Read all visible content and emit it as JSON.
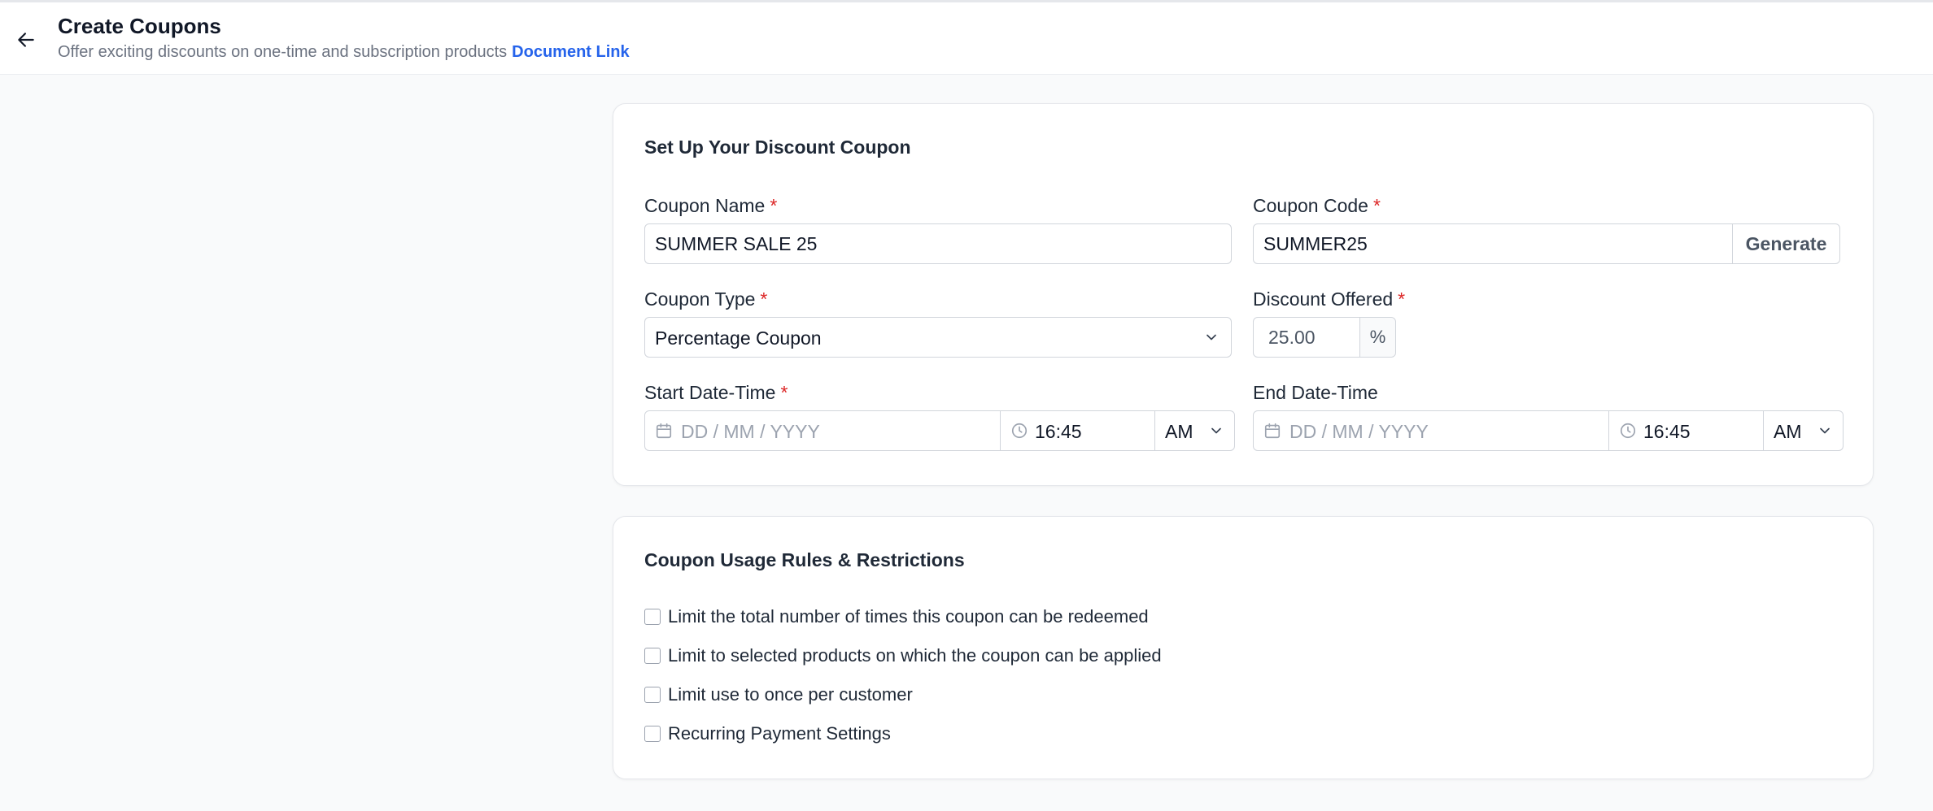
{
  "header": {
    "title": "Create Coupons",
    "subtitle": "Offer exciting discounts on one-time and subscription products",
    "doc_link": "Document Link"
  },
  "setup": {
    "title": "Set Up Your Discount Coupon",
    "coupon_name": {
      "label": "Coupon Name",
      "value": "SUMMER SALE 25"
    },
    "coupon_code": {
      "label": "Coupon Code",
      "value": "SUMMER25",
      "generate_label": "Generate"
    },
    "coupon_type": {
      "label": "Coupon Type",
      "value": "Percentage Coupon"
    },
    "discount": {
      "label": "Discount Offered",
      "value": "25.00",
      "unit": "%"
    },
    "start": {
      "label": "Start Date-Time",
      "date_placeholder": "DD / MM / YYYY",
      "time": "16:45",
      "ampm": "AM"
    },
    "end": {
      "label": "End Date-Time",
      "date_placeholder": "DD / MM / YYYY",
      "time": "16:45",
      "ampm": "AM"
    },
    "required_mark": "*"
  },
  "rules": {
    "title": "Coupon Usage Rules & Restrictions",
    "options": [
      {
        "label": "Limit the total number of times this coupon can be redeemed",
        "checked": false
      },
      {
        "label": "Limit to selected products on which the coupon can be applied",
        "checked": false
      },
      {
        "label": "Limit use to once per customer",
        "checked": false
      },
      {
        "label": "Recurring Payment Settings",
        "checked": false
      }
    ]
  },
  "colors": {
    "accent": "#2563eb",
    "required": "#dc2626",
    "border": "#d1d5db"
  },
  "icons": {
    "back": "arrow-left-icon",
    "calendar": "calendar-icon",
    "clock": "clock-icon",
    "chevron": "chevron-down-icon"
  }
}
